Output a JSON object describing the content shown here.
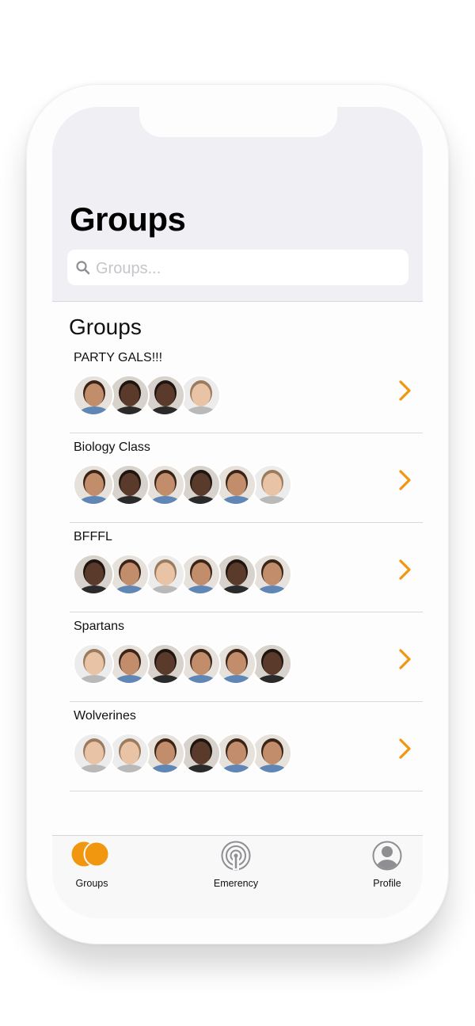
{
  "header": {
    "title": "Groups",
    "search_placeholder": "Groups..."
  },
  "section": {
    "title": "Groups"
  },
  "groups": [
    {
      "name": "PARTY GALS!!!",
      "members": [
        "tan",
        "dark",
        "dark",
        "light"
      ]
    },
    {
      "name": "Biology Class",
      "members": [
        "tan",
        "dark",
        "tan",
        "dark",
        "tan",
        "light"
      ]
    },
    {
      "name": "BFFFL",
      "members": [
        "dark",
        "tan",
        "light",
        "tan",
        "dark",
        "tan"
      ]
    },
    {
      "name": "Spartans",
      "members": [
        "light",
        "tan",
        "dark",
        "tan",
        "tan",
        "dark"
      ]
    },
    {
      "name": "Wolverines",
      "members": [
        "light",
        "light",
        "tan",
        "dark",
        "tan",
        "tan"
      ]
    }
  ],
  "tabbar": {
    "groups_label": "Groups",
    "emergency_label": "Emerency",
    "profile_label": "Profile"
  },
  "colors": {
    "accent": "#f0960f",
    "header_bg": "#efeff4"
  },
  "icons": {
    "search": "search-icon",
    "chevron": "chevron-right-icon",
    "groups_tab": "groups-tab-icon",
    "emergency_tab": "emergency-tab-icon",
    "profile_tab": "profile-tab-icon"
  }
}
